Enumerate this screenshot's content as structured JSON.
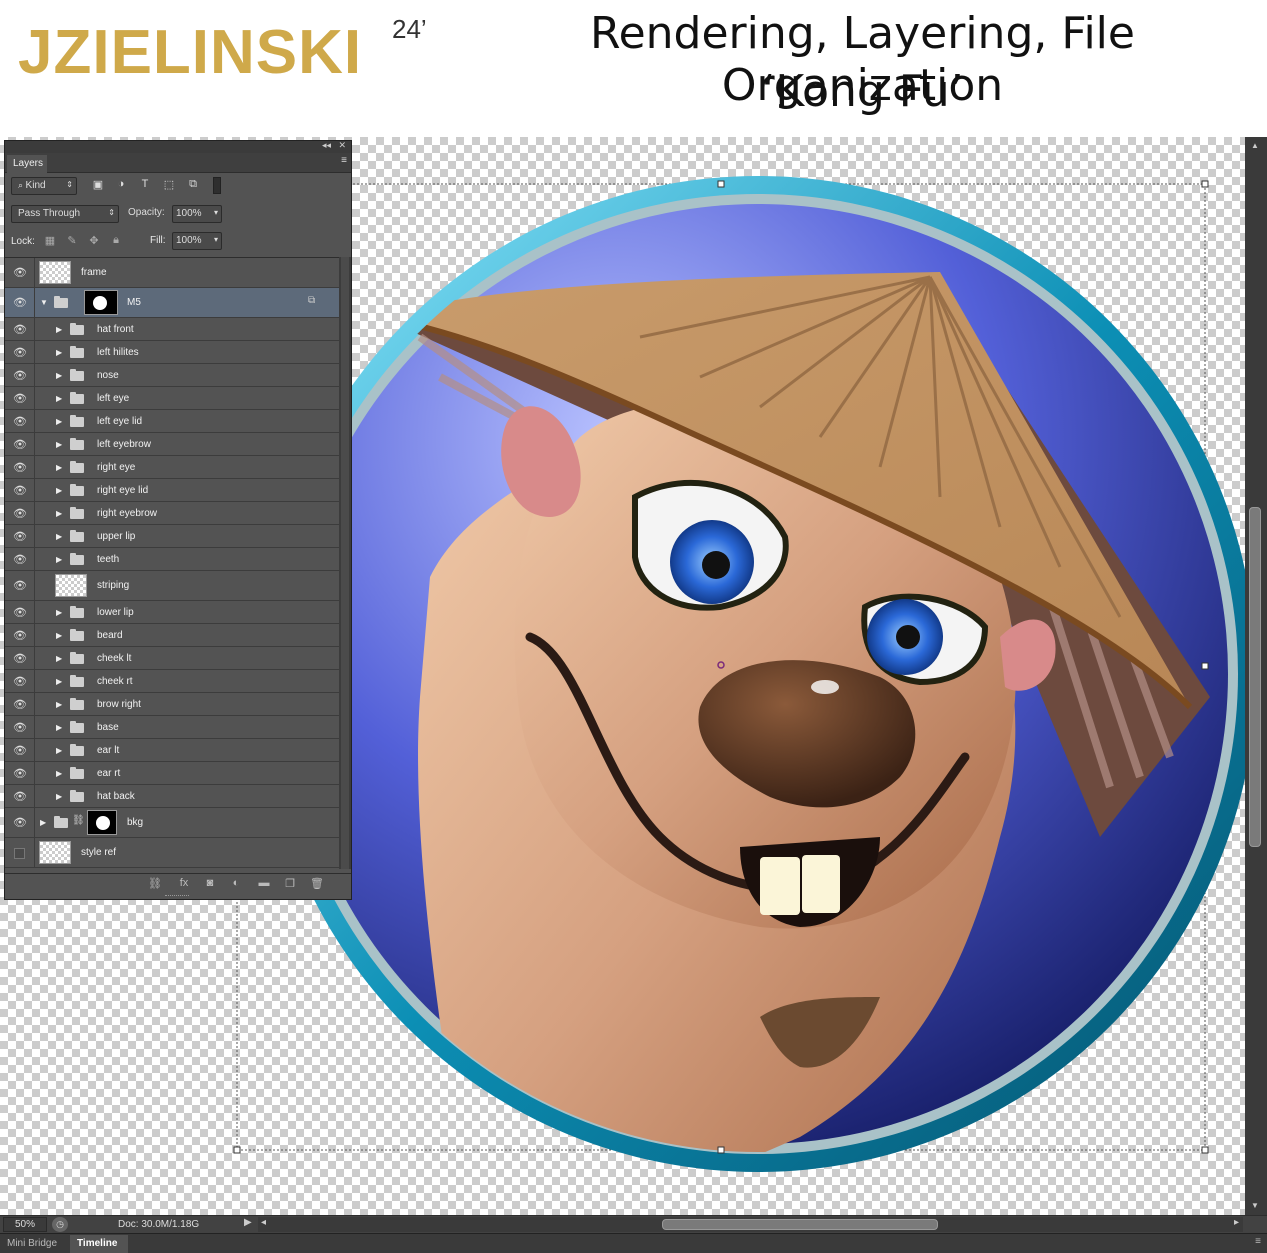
{
  "banner": {
    "logo_text": "JZIELINSKI",
    "logo_superscript": "24’",
    "title_line1": "Rendering, Layering, File Organization",
    "title_line2": "‘Kong Fu’"
  },
  "layers_panel": {
    "tab_label": "Layers",
    "kind_label": "Kind",
    "blend_mode": "Pass Through",
    "opacity_label": "Opacity:",
    "opacity_value": "100%",
    "lock_label": "Lock:",
    "fill_label": "Fill:",
    "fill_value": "100%",
    "layers": [
      {
        "name": "frame",
        "type": "layer",
        "visible": true
      },
      {
        "name": "M5",
        "type": "group-open",
        "visible": true,
        "selected": true
      },
      {
        "name": "hat front",
        "type": "group",
        "visible": true
      },
      {
        "name": "left hilites",
        "type": "group",
        "visible": true
      },
      {
        "name": "nose",
        "type": "group",
        "visible": true
      },
      {
        "name": "left eye",
        "type": "group",
        "visible": true
      },
      {
        "name": "left eye lid",
        "type": "group",
        "visible": true
      },
      {
        "name": "left eyebrow",
        "type": "group",
        "visible": true
      },
      {
        "name": "right eye",
        "type": "group",
        "visible": true
      },
      {
        "name": "right eye lid",
        "type": "group",
        "visible": true
      },
      {
        "name": "right eyebrow",
        "type": "group",
        "visible": true
      },
      {
        "name": "upper lip",
        "type": "group",
        "visible": true
      },
      {
        "name": "teeth",
        "type": "group",
        "visible": true
      },
      {
        "name": "striping",
        "type": "layer",
        "visible": true
      },
      {
        "name": "lower lip",
        "type": "group",
        "visible": true
      },
      {
        "name": "beard",
        "type": "group",
        "visible": true
      },
      {
        "name": "cheek lt",
        "type": "group",
        "visible": true
      },
      {
        "name": "cheek rt",
        "type": "group",
        "visible": true
      },
      {
        "name": "brow right",
        "type": "group",
        "visible": true
      },
      {
        "name": "base",
        "type": "group",
        "visible": true
      },
      {
        "name": "ear lt",
        "type": "group",
        "visible": true
      },
      {
        "name": "ear rt",
        "type": "group",
        "visible": true
      },
      {
        "name": "hat back",
        "type": "group",
        "visible": true
      },
      {
        "name": "bkg",
        "type": "group-masked",
        "visible": true
      },
      {
        "name": "style ref",
        "type": "layer",
        "visible": false
      }
    ]
  },
  "status": {
    "zoom": "50%",
    "doc_info": "Doc: 30.0M/1.18G"
  },
  "bottom_tabs": [
    "Mini Bridge",
    "Timeline"
  ],
  "colors": {
    "logo_gold": "#cfa94a",
    "frame_teal": "#13a6c9",
    "panel_bg": "#535353",
    "selected_row": "#5d6a7a"
  }
}
